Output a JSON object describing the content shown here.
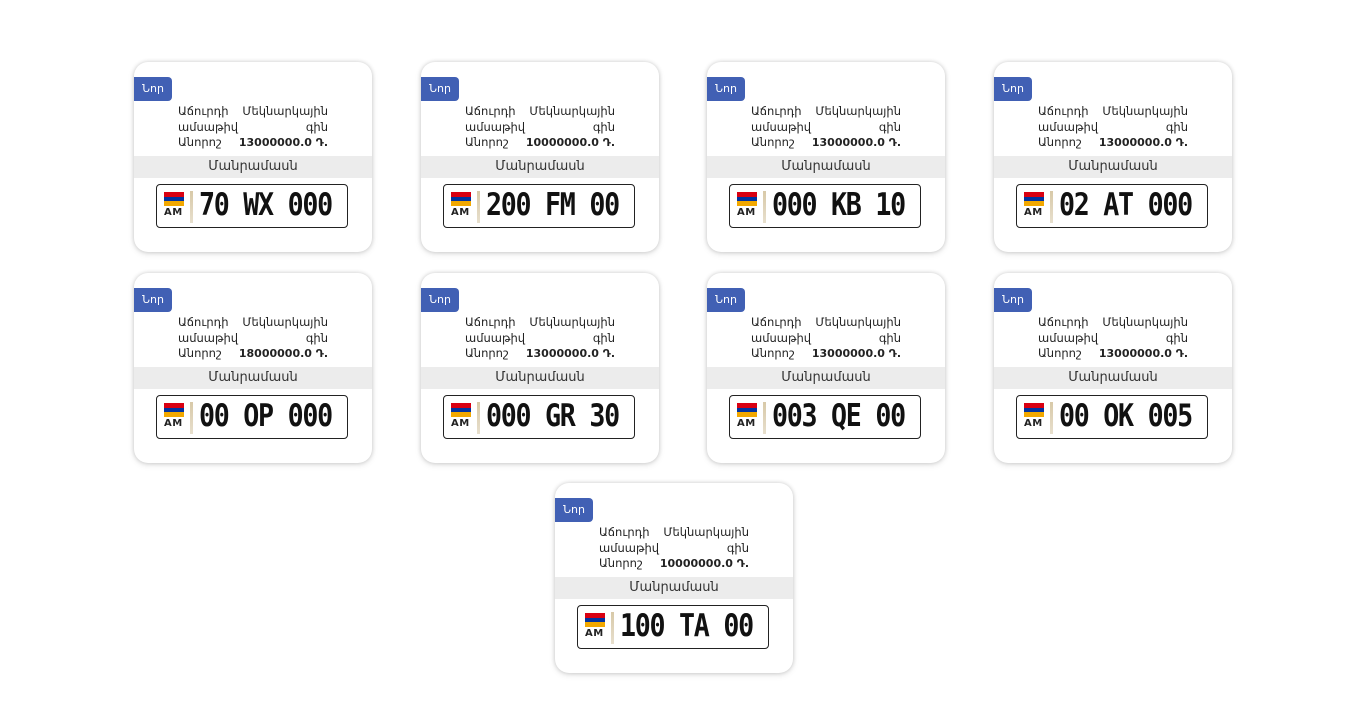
{
  "colors": {
    "badge": "#4160b4",
    "flag_red": "#d90012",
    "flag_blue": "#0033a0",
    "flag_orange": "#f2a800"
  },
  "cards": [
    {
      "badge": "Նոր",
      "label_1": "Աճուրդի",
      "label_2": "Մեկնարկային",
      "label_3": "ամսաթիվ",
      "label_4": "գին",
      "label_5": "Անորոշ",
      "price": "13000000.0 Դ.",
      "details": "Մանրամասն",
      "plate_code": "AM",
      "plate_number": "70 WX 000"
    },
    {
      "badge": "Նոր",
      "label_1": "Աճուրդի",
      "label_2": "Մեկնարկային",
      "label_3": "ամսաթիվ",
      "label_4": "գին",
      "label_5": "Անորոշ",
      "price": "10000000.0 Դ.",
      "details": "Մանրամասն",
      "plate_code": "AM",
      "plate_number": "200 FM 00"
    },
    {
      "badge": "Նոր",
      "label_1": "Աճուրդի",
      "label_2": "Մեկնարկային",
      "label_3": "ամսաթիվ",
      "label_4": "գին",
      "label_5": "Անորոշ",
      "price": "13000000.0 Դ.",
      "details": "Մանրամասն",
      "plate_code": "AM",
      "plate_number": "000 KB 10"
    },
    {
      "badge": "Նոր",
      "label_1": "Աճուրդի",
      "label_2": "Մեկնարկային",
      "label_3": "ամսաթիվ",
      "label_4": "գին",
      "label_5": "Անորոշ",
      "price": "13000000.0 Դ.",
      "details": "Մանրամասն",
      "plate_code": "AM",
      "plate_number": "02 AT 000"
    },
    {
      "badge": "Նոր",
      "label_1": "Աճուրդի",
      "label_2": "Մեկնարկային",
      "label_3": "ամսաթիվ",
      "label_4": "գին",
      "label_5": "Անորոշ",
      "price": "18000000.0 Դ.",
      "details": "Մանրամասն",
      "plate_code": "AM",
      "plate_number": "00 OP 000"
    },
    {
      "badge": "Նոր",
      "label_1": "Աճուրդի",
      "label_2": "Մեկնարկային",
      "label_3": "ամսաթիվ",
      "label_4": "գին",
      "label_5": "Անորոշ",
      "price": "13000000.0 Դ.",
      "details": "Մանրամասն",
      "plate_code": "AM",
      "plate_number": "000 GR 30"
    },
    {
      "badge": "Նոր",
      "label_1": "Աճուրդի",
      "label_2": "Մեկնարկային",
      "label_3": "ամսաթիվ",
      "label_4": "գին",
      "label_5": "Անորոշ",
      "price": "13000000.0 Դ.",
      "details": "Մանրամասն",
      "plate_code": "AM",
      "plate_number": "003 QE 00"
    },
    {
      "badge": "Նոր",
      "label_1": "Աճուրդի",
      "label_2": "Մեկնարկային",
      "label_3": "ամսաթիվ",
      "label_4": "գին",
      "label_5": "Անորոշ",
      "price": "13000000.0 Դ.",
      "details": "Մանրամասն",
      "plate_code": "AM",
      "plate_number": "00 OK 005"
    },
    {
      "badge": "Նոր",
      "label_1": "Աճուրդի",
      "label_2": "Մեկնարկային",
      "label_3": "ամսաթիվ",
      "label_4": "գին",
      "label_5": "Անորոշ",
      "price": "10000000.0 Դ.",
      "details": "Մանրամասն",
      "plate_code": "AM",
      "plate_number": "100 TA 00"
    }
  ]
}
